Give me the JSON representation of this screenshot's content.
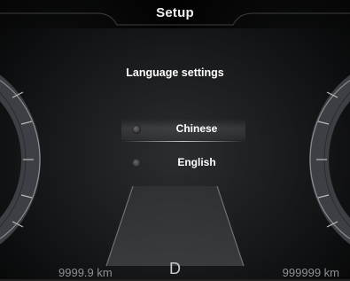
{
  "header": {
    "title": "Setup"
  },
  "settings": {
    "subtitle": "Language settings",
    "options": [
      {
        "label": "Chinese",
        "selected": true
      },
      {
        "label": "English",
        "selected": false
      }
    ]
  },
  "footer": {
    "odometer": "9999.9 km",
    "gear": "D",
    "trip": "999999 km"
  },
  "colors": {
    "background": "#1a1b1d",
    "text": "#ffffff",
    "footer_text": "#8e9093"
  }
}
